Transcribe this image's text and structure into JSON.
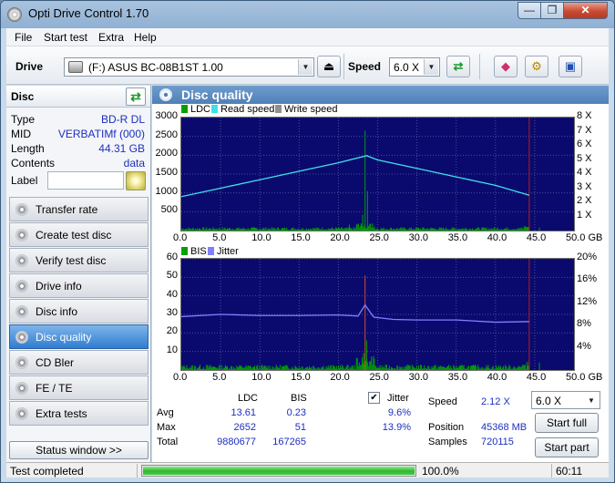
{
  "window": {
    "title": "Opti Drive Control 1.70",
    "min": "—",
    "max": "❐",
    "close": "✕"
  },
  "menu": [
    "File",
    "Start test",
    "Extra",
    "Help"
  ],
  "toolbar": {
    "drive_label": "Drive",
    "drive_value": "(F:)   ASUS BC-08B1ST 1.00",
    "speed_label": "Speed",
    "speed_value": "6.0 X",
    "arrow": "▼"
  },
  "disc": {
    "title": "Disc",
    "rows": [
      {
        "label": "Type",
        "value": "BD-R DL"
      },
      {
        "label": "MID",
        "value": "VERBATIMf (000)"
      },
      {
        "label": "Length",
        "value": "44.31 GB"
      },
      {
        "label": "Contents",
        "value": "data"
      }
    ],
    "label_field": "Label"
  },
  "nav": [
    "Transfer rate",
    "Create test disc",
    "Verify test disc",
    "Drive info",
    "Disc info",
    "Disc quality",
    "CD Bler",
    "FE / TE",
    "Extra tests"
  ],
  "nav_active": 5,
  "status_window": "Status window >>",
  "main": {
    "title": "Disc quality"
  },
  "legend_top": [
    "LDC",
    "Read speed",
    "Write speed"
  ],
  "legend_bottom": [
    "BIS",
    "Jitter"
  ],
  "colors": {
    "ldc": "#00a000",
    "read_speed": "#40e0e8",
    "write_speed": "#909090",
    "bis": "#00a000",
    "jitter": "#8080ff",
    "bg": "#0a0a6e"
  },
  "chart_data": [
    {
      "type": "line",
      "series": [
        {
          "name": "LDC",
          "kind": "bar"
        },
        {
          "name": "Read speed",
          "x": [
            0,
            5,
            10,
            15,
            20,
            23.6,
            25,
            30,
            35,
            40,
            44.3
          ],
          "y": [
            2.4,
            3.0,
            3.6,
            4.2,
            4.8,
            5.3,
            5.0,
            4.4,
            3.8,
            3.2,
            2.5
          ]
        }
      ],
      "x_ticks": [
        "0.0",
        "5.0",
        "10.0",
        "15.0",
        "20.0",
        "25.0",
        "30.0",
        "35.0",
        "40.0",
        "45.0",
        "50.0 GB"
      ],
      "y_left_ticks": [
        "3000",
        "2500",
        "2000",
        "1500",
        "1000",
        "500"
      ],
      "y_right_ticks": [
        "8 X",
        "7 X",
        "6 X",
        "5 X",
        "4 X",
        "3 X",
        "2 X",
        "1 X"
      ],
      "xlim": [
        0,
        50
      ],
      "ylim_left": [
        0,
        3000
      ],
      "ylim_right": [
        0,
        8
      ]
    },
    {
      "type": "line",
      "series": [
        {
          "name": "BIS",
          "kind": "bar"
        },
        {
          "name": "Jitter",
          "x": [
            0,
            5,
            10,
            15,
            20,
            22.5,
            23.4,
            24.5,
            27,
            30,
            35,
            40,
            44.3
          ],
          "y": [
            9.6,
            10.0,
            9.8,
            9.8,
            9.9,
            9.7,
            11.7,
            9.5,
            9.1,
            9.0,
            9.0,
            8.6,
            8.7
          ]
        }
      ],
      "x_ticks": [
        "0.0",
        "5.0",
        "10.0",
        "15.0",
        "20.0",
        "25.0",
        "30.0",
        "35.0",
        "40.0",
        "45.0",
        "50.0 GB"
      ],
      "y_left_ticks": [
        "60",
        "50",
        "40",
        "30",
        "20",
        "10"
      ],
      "y_right_ticks": [
        "20%",
        "16%",
        "12%",
        "8%",
        "4%"
      ],
      "xlim": [
        0,
        50
      ],
      "ylim_left": [
        0,
        60
      ],
      "ylim_right": [
        0,
        20
      ]
    }
  ],
  "stats": {
    "col_ldc": "LDC",
    "col_bis": "BIS",
    "jitter_label": "Jitter",
    "check": "✔",
    "rows": [
      {
        "label": "Avg",
        "ldc": "13.61",
        "bis": "0.23",
        "jitter": "9.6%"
      },
      {
        "label": "Max",
        "ldc": "2652",
        "bis": "51",
        "jitter": "13.9%"
      },
      {
        "label": "Total",
        "ldc": "9880677",
        "bis": "167265",
        "jitter": ""
      }
    ],
    "speed_label": "Speed",
    "speed_value": "2.12 X",
    "speed_select": "6.0 X",
    "position_label": "Position",
    "position_value": "45368 MB",
    "samples_label": "Samples",
    "samples_value": "720115",
    "start_full": "Start full",
    "start_part": "Start part"
  },
  "status": {
    "text": "Test completed",
    "progress": 100.0,
    "progress_text": "100.0%",
    "time": "60:11"
  }
}
